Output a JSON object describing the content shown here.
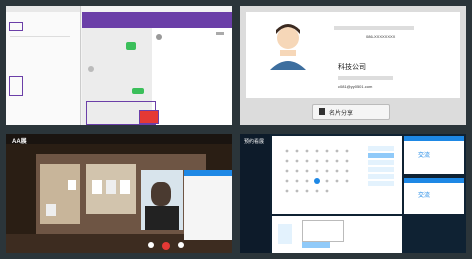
{
  "panel2": {
    "company": "科技公司",
    "phone": "086-XXXXXXXX",
    "email": "c081@yy0501.com",
    "share_button": "名片分享"
  },
  "panel3": {
    "title": "AA展"
  },
  "panel4": {
    "sidebar_title": "预约看展",
    "card1_title": "交流",
    "card2_title": "交流"
  },
  "colors": {
    "purple": "#6b3fa8",
    "green": "#3bbf5a",
    "blue": "#1e88e5",
    "red": "#e53935"
  }
}
